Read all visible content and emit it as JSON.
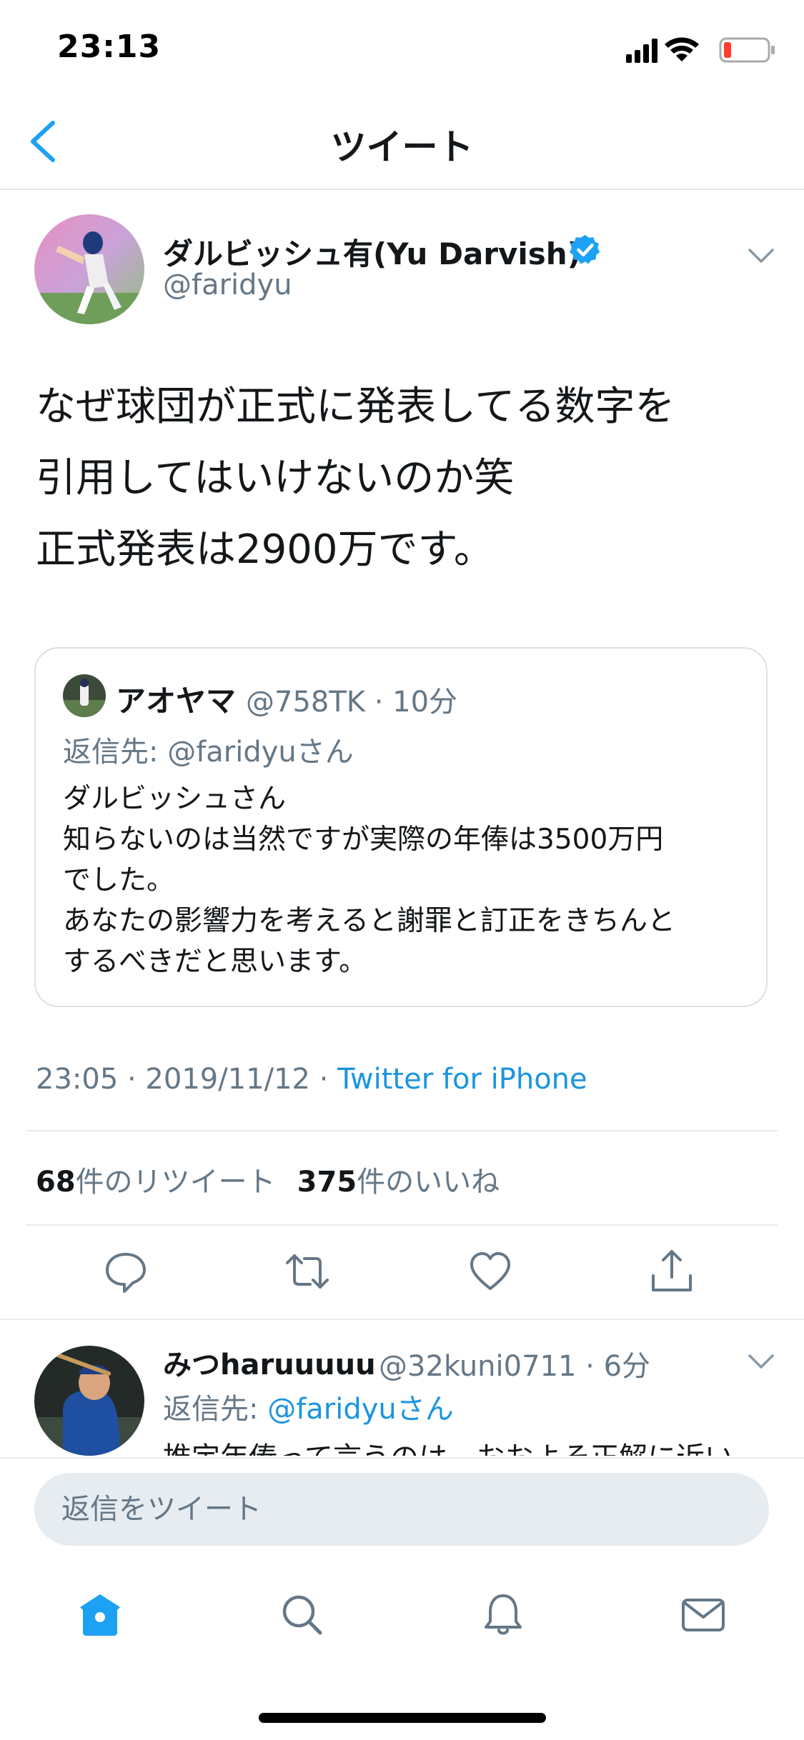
{
  "status_bar": {
    "time": "23:13",
    "battery_color": "#ff3b30"
  },
  "nav": {
    "title": "ツイート",
    "back_icon": "chevron-left-icon"
  },
  "tweet": {
    "author": {
      "name": "ダルビッシュ有(Yu Darvish)",
      "handle": "@faridyu",
      "verified": true
    },
    "text": "なぜ球団が正式に発表してる数字を\n引用してはいけないのか笑\n正式発表は2900万です。",
    "quote": {
      "author_name": "アオヤマ",
      "handle_time": "@758TK · 10分",
      "reply_to": "返信先: @faridyuさん",
      "text": "ダルビッシュさん\n知らないのは当然ですが実際の年俸は3500万円\nでした。\nあなたの影響力を考えると謝罪と訂正をきちんと\nするべきだと思います。"
    },
    "timestamp": "23:05 · 2019/11/12 · ",
    "source": "Twitter for iPhone",
    "retweet_count": "68",
    "retweet_label": "件のリツイート",
    "like_count": "375",
    "like_label": "件のいいね",
    "actions": [
      "reply-icon",
      "retweet-icon",
      "like-icon",
      "share-icon"
    ]
  },
  "reply": {
    "author_name": "みつharuuuuu",
    "handle_time": "@32kuni0711 · 6分",
    "reply_prefix": "返信先: ",
    "reply_mention": "@faridyuさん",
    "text_partial": "推定年俸って言うのは、おおよそ正解に近い"
  },
  "compose": {
    "placeholder": "返信をツイート"
  },
  "tabbar": [
    "home-icon",
    "search-icon",
    "notifications-icon",
    "messages-icon"
  ],
  "colors": {
    "accent": "#1da1f2",
    "link": "#1b95e0",
    "muted": "#657786",
    "verified": "#1da1f2"
  }
}
